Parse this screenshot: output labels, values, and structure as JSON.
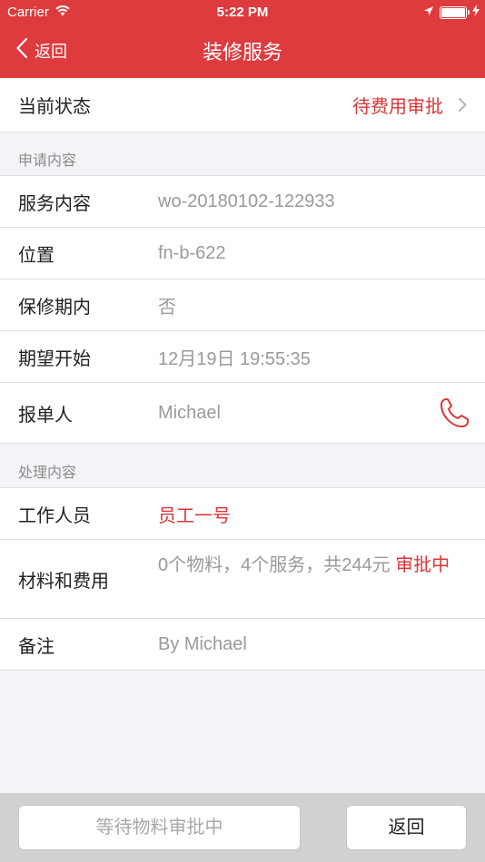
{
  "status_bar": {
    "carrier": "Carrier",
    "time": "5:22 PM"
  },
  "nav": {
    "back_label": "返回",
    "title": "装修服务"
  },
  "current_status": {
    "label": "当前状态",
    "value": "待费用审批"
  },
  "application": {
    "section_title": "申请内容",
    "rows": [
      {
        "label": "服务内容",
        "value": "wo-20180102-122933"
      },
      {
        "label": "位置",
        "value": "fn-b-622"
      },
      {
        "label": "保修期内",
        "value": "否"
      },
      {
        "label": "期望开始",
        "value": "12月19日 19:55:35"
      },
      {
        "label": "报单人",
        "value": "Michael"
      }
    ]
  },
  "processing": {
    "section_title": "处理内容",
    "worker": {
      "label": "工作人员",
      "value": "员工一号"
    },
    "materials": {
      "label": "材料和费用",
      "value_summary": "0个物料，4个服务，共244元",
      "value_status": "审批中"
    },
    "remark": {
      "label": "备注",
      "value": "By Michael"
    }
  },
  "footer": {
    "waiting_button": "等待物料审批中",
    "back_button": "返回"
  },
  "colors": {
    "brand_red": "#dd3b3e",
    "accent_red": "#d9363a",
    "background": "#f4f3f8"
  }
}
